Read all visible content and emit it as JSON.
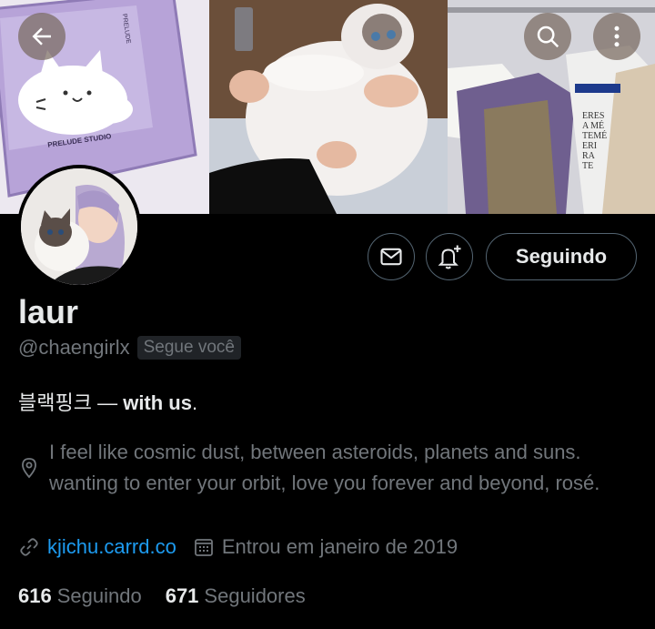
{
  "header": {
    "panel1_caption": "PRELUDE STUDIO",
    "panel1_vertical": "PRELUDE",
    "panel3_text": "ERES\nA MÉ\nTEMÉ\nERI\nRA\nTE"
  },
  "profile": {
    "display_name": "laur",
    "handle": "@chaengirlx",
    "follows_you": "Segue você",
    "bio_korean": "블랙핑크",
    "bio_sep": " — ",
    "bio_bold": "with us",
    "bio_end": ".",
    "location": "I feel like cosmic dust, between asteroids, planets and suns. wanting to enter your orbit, love you forever and beyond, rosé.",
    "website": "kjichu.carrd.co",
    "joined": "Entrou em janeiro de 2019"
  },
  "actions": {
    "follow_label": "Seguindo"
  },
  "stats": {
    "following_count": "616",
    "following_label": "Seguindo",
    "followers_count": "671",
    "followers_label": "Seguidores"
  },
  "colors": {
    "background": "#000000",
    "text": "#e7e9ea",
    "muted": "#71767b",
    "link": "#1d9bf0",
    "border": "#536471"
  },
  "icons": [
    "back-arrow-icon",
    "search-icon",
    "more-vertical-icon",
    "mail-icon",
    "bell-plus-icon",
    "location-icon",
    "link-icon",
    "calendar-icon"
  ]
}
